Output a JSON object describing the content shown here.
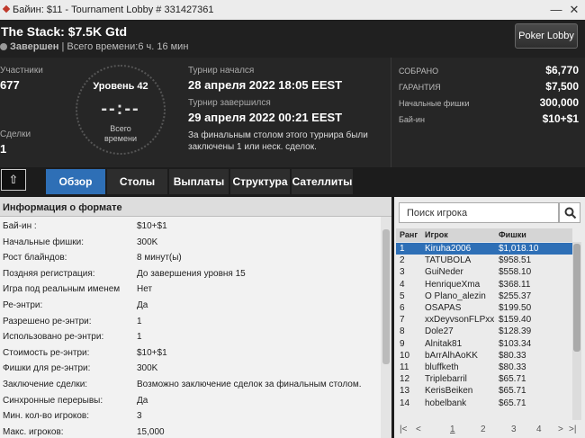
{
  "window": {
    "title": "Байин: $11 - Tournament Lobby # 331427361",
    "minimize": "—",
    "close": "✕"
  },
  "tournament": {
    "name": "The Stack: $7.5K Gtd",
    "status": "Завершен",
    "total_time": "| Всего времени:6 ч. 16 мин",
    "lobby_button": "Poker Lobby"
  },
  "stats": {
    "participants_label": "Участники",
    "participants_value": "677",
    "deals_label": "Сделки",
    "deals_value": "1",
    "level": "Уровень 42",
    "clock": "--:--",
    "clock_label_1": "Всего",
    "clock_label_2": "времени",
    "started_label": "Турнир начался",
    "started_value": "28 апреля 2022   18:05 EEST",
    "ended_label": "Турнир завершился",
    "ended_value": "29 апреля 2022   00:21 EEST",
    "final_table_note": "За финальным столом этого турнира были заключены 1 или неск. сделок."
  },
  "prize": [
    {
      "key": "СОБРАНО",
      "value": "$6,770"
    },
    {
      "key": "ГАРАНТИЯ",
      "value": "$7,500"
    },
    {
      "key": "Начальные фишки",
      "value": "300,000"
    },
    {
      "key": "Бай-ин",
      "value": "$10+$1"
    }
  ],
  "tabs": [
    "Обзор",
    "Столы",
    "Выплаты",
    "Структура",
    "Сателлиты"
  ],
  "format": {
    "header": "Информация о формате",
    "rows": [
      {
        "k": "Бай-ин :",
        "v": "$10+$1"
      },
      {
        "k": "Начальные фишки:",
        "v": "300K"
      },
      {
        "k": "Рост блайндов:",
        "v": "8 минут(ы)"
      },
      {
        "k": "Поздняя регистрация:",
        "v": "До завершения уровня 15"
      },
      {
        "k": "Игра под реальным именем",
        "v": "Нет"
      },
      {
        "k": "Ре-энтри:",
        "v": "Да"
      },
      {
        "k": "Разрешено ре-энтри:",
        "v": "1"
      },
      {
        "k": "Использовано ре-энтри:",
        "v": "1"
      },
      {
        "k": "Стоимость ре-энтри:",
        "v": "$10+$1"
      },
      {
        "k": "Фишки для ре-энтри:",
        "v": "300K"
      },
      {
        "k": "Заключение сделки:",
        "v": "Возможно заключение сделок за финальным столом."
      },
      {
        "k": "Синхронные перерывы:",
        "v": "Да"
      },
      {
        "k": "Мин. кол-во игроков:",
        "v": "3"
      },
      {
        "k": "Макс. игроков:",
        "v": "15,000"
      }
    ]
  },
  "players": {
    "search_placeholder": "Поиск игрока",
    "col_rank": "Ранг",
    "col_player": "Игрок",
    "col_chips": "Фишки",
    "rows": [
      {
        "rank": "1",
        "name": "Kiruha2006",
        "chips": "$1,018.10"
      },
      {
        "rank": "2",
        "name": "TATUBOLA",
        "chips": "$958.51"
      },
      {
        "rank": "3",
        "name": "GuiNeder",
        "chips": "$558.10"
      },
      {
        "rank": "4",
        "name": "HenriqueXma",
        "chips": "$368.11"
      },
      {
        "rank": "5",
        "name": "O Plano_alezin",
        "chips": "$255.37"
      },
      {
        "rank": "6",
        "name": "OSAPAS",
        "chips": "$199.50"
      },
      {
        "rank": "7",
        "name": "xxDeyvsonFLPxx",
        "chips": "$159.40"
      },
      {
        "rank": "8",
        "name": "Dole27",
        "chips": "$128.39"
      },
      {
        "rank": "9",
        "name": "Alnitak81",
        "chips": "$103.34"
      },
      {
        "rank": "10",
        "name": "bArrAlhAoKK",
        "chips": "$80.33"
      },
      {
        "rank": "11",
        "name": "bluffketh",
        "chips": "$80.33"
      },
      {
        "rank": "12",
        "name": "Triplebarril",
        "chips": "$65.71"
      },
      {
        "rank": "13",
        "name": "KerisBeiken",
        "chips": "$65.71"
      },
      {
        "rank": "14",
        "name": "hobelbank",
        "chips": "$65.71"
      }
    ],
    "pager": [
      "|<",
      "<",
      "1",
      "2",
      "3",
      "4",
      ">",
      ">|"
    ]
  },
  "colors": {
    "accent": "#2e6fb6"
  }
}
